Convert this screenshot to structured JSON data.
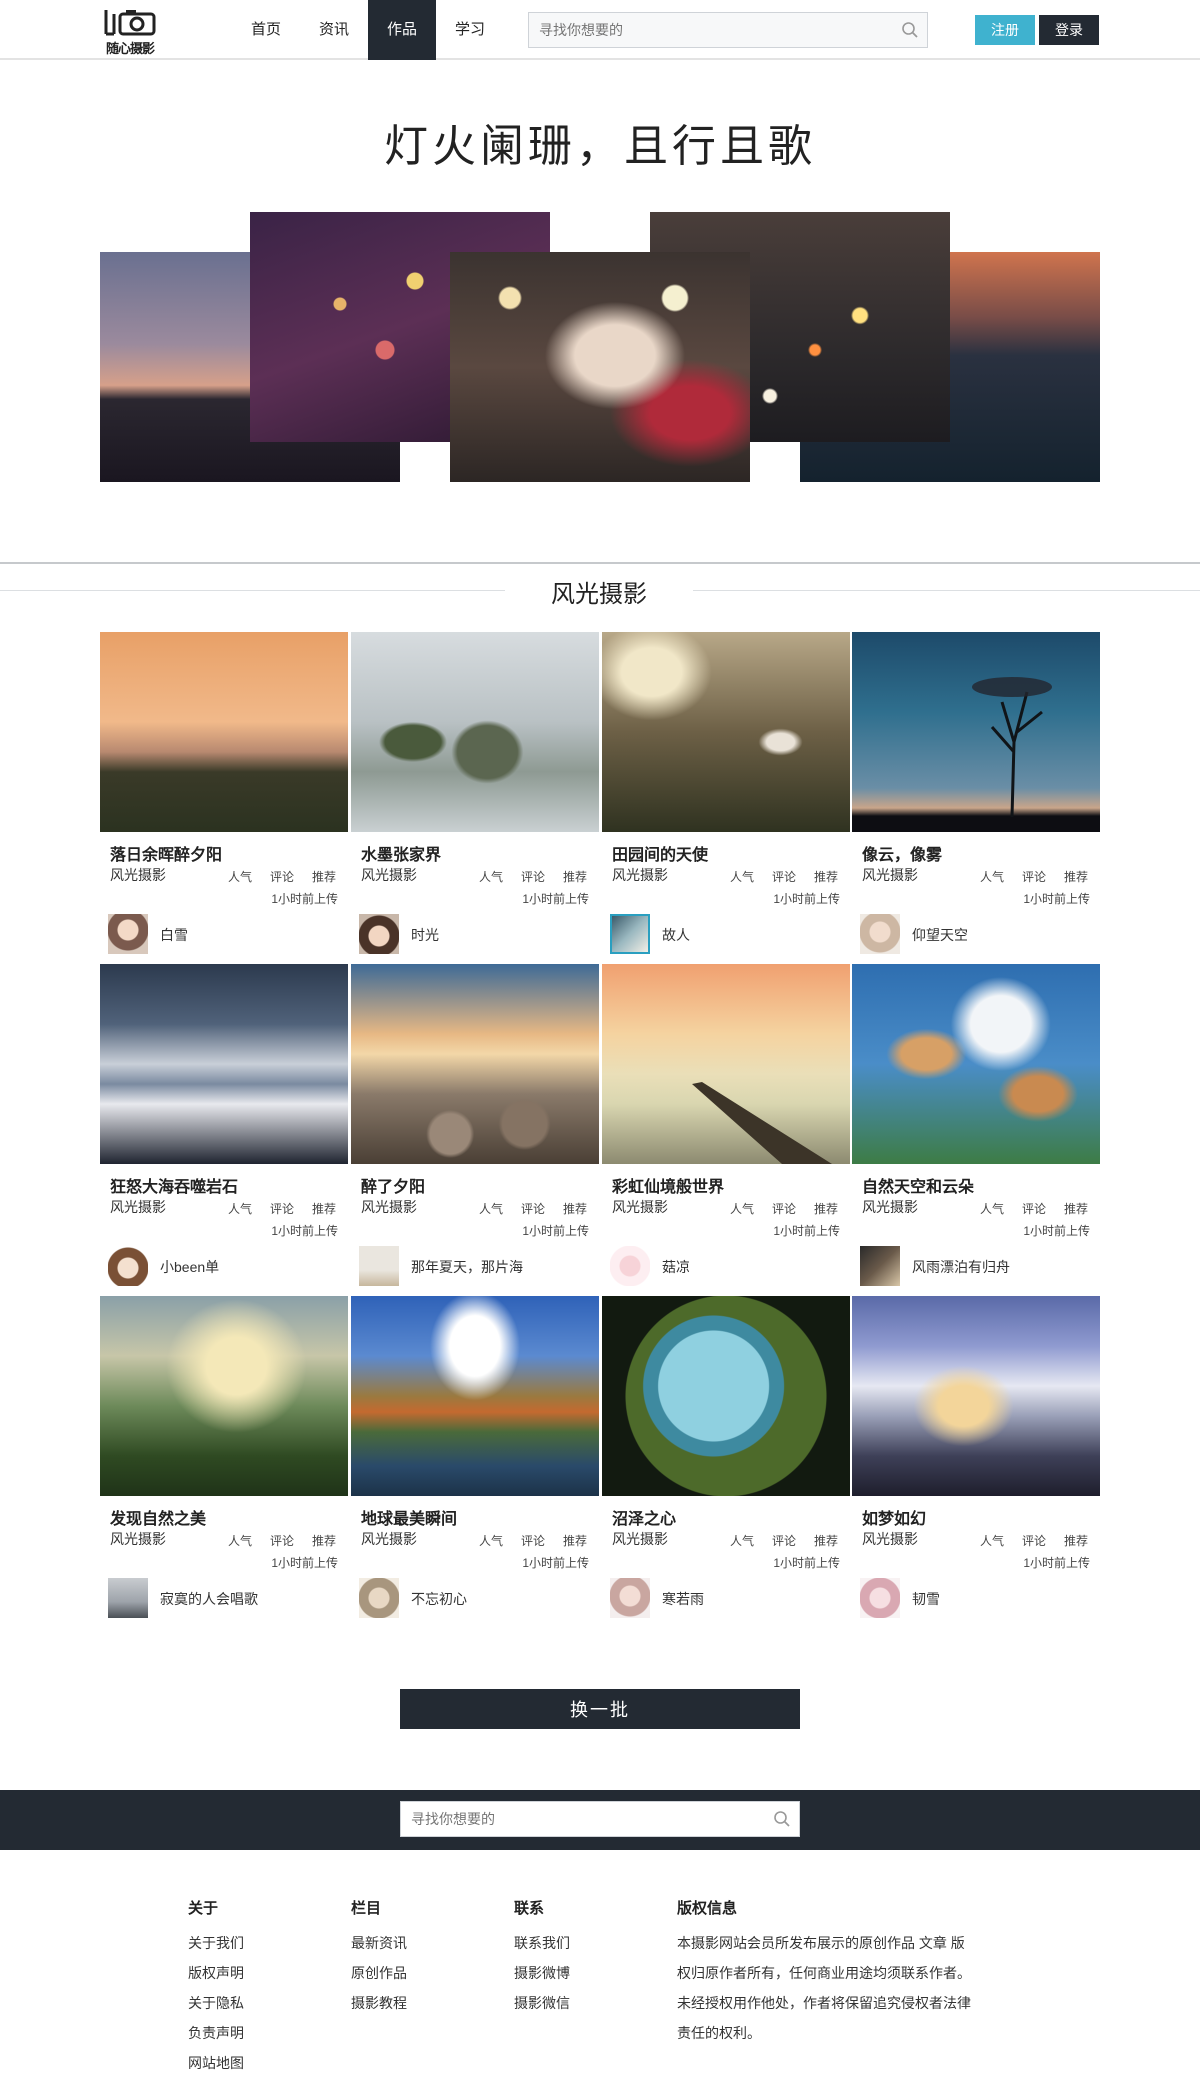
{
  "header": {
    "logo_text": "随心摄影",
    "nav": [
      "首页",
      "资讯",
      "作品",
      "学习"
    ],
    "active_nav": "作品",
    "search_placeholder": "寻找你想要的",
    "register_label": "注册",
    "login_label": "登录"
  },
  "hero": {
    "title": "灯火阑珊，且行且歌"
  },
  "section": {
    "title": "风光摄影"
  },
  "stats_labels": {
    "popularity": "人气",
    "comments": "评论",
    "recommend": "推荐"
  },
  "cards": [
    {
      "title": "落日余晖醉夕阳",
      "category": "风光摄影",
      "time": "1小时前上传",
      "author": "白雪"
    },
    {
      "title": "水墨张家界",
      "category": "风光摄影",
      "time": "1小时前上传",
      "author": "时光"
    },
    {
      "title": "田园间的天使",
      "category": "风光摄影",
      "time": "1小时前上传",
      "author": "故人"
    },
    {
      "title": "像云，像雾",
      "category": "风光摄影",
      "time": "1小时前上传",
      "author": "仰望天空"
    },
    {
      "title": "狂怒大海吞噬岩石",
      "category": "风光摄影",
      "time": "1小时前上传",
      "author": "小been单"
    },
    {
      "title": "醉了夕阳",
      "category": "风光摄影",
      "time": "1小时前上传",
      "author": "那年夏天，那片海"
    },
    {
      "title": "彩虹仙境般世界",
      "category": "风光摄影",
      "time": "1小时前上传",
      "author": "菇凉"
    },
    {
      "title": "自然天空和云朵",
      "category": "风光摄影",
      "time": "1小时前上传",
      "author": "风雨漂泊有归舟"
    },
    {
      "title": "发现自然之美",
      "category": "风光摄影",
      "time": "1小时前上传",
      "author": "寂寞的人会唱歌"
    },
    {
      "title": "地球最美瞬间",
      "category": "风光摄影",
      "time": "1小时前上传",
      "author": "不忘初心"
    },
    {
      "title": "沼泽之心",
      "category": "风光摄影",
      "time": "1小时前上传",
      "author": "寒若雨"
    },
    {
      "title": "如梦如幻",
      "category": "风光摄影",
      "time": "1小时前上传",
      "author": "韧雪"
    }
  ],
  "more_button": "换一批",
  "footer": {
    "search_placeholder": "寻找你想要的",
    "columns": [
      {
        "heading": "关于",
        "links": [
          "关于我们",
          "版权声明",
          "关于隐私",
          "负责声明",
          "网站地图"
        ]
      },
      {
        "heading": "栏目",
        "links": [
          "最新资讯",
          "原创作品",
          "摄影教程"
        ]
      },
      {
        "heading": "联系",
        "links": [
          "联系我们",
          "摄影微博",
          "摄影微信"
        ]
      }
    ],
    "copyright": {
      "heading": "版权信息",
      "text": "本摄影网站会员所发布展示的原创作品 文章 版权归原作者所有，任何商业用途均须联系作者。未经授权用作他处，作者将保留追究侵权者法律责任的权利。"
    }
  },
  "colors": {
    "dark": "#232a33",
    "accent": "#3fb2cf"
  }
}
